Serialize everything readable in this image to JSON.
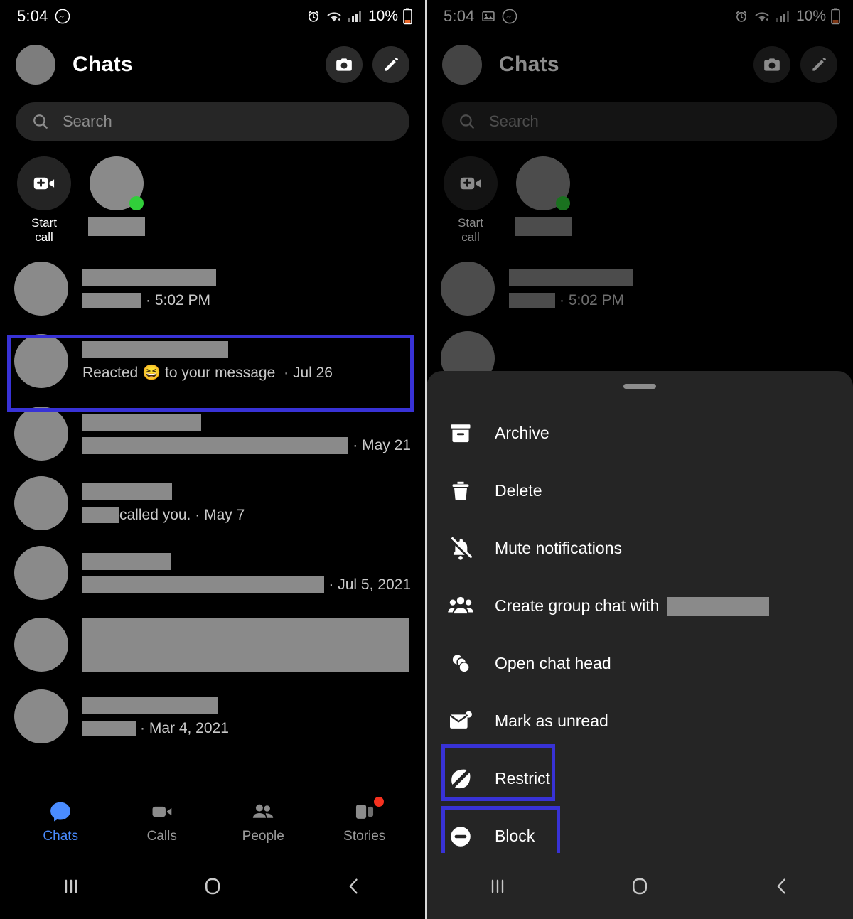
{
  "left_phone": {
    "status_bar": {
      "time": "5:04",
      "icons": [
        "messenger-icon",
        "alarm-icon",
        "wifi-icon",
        "signal-icon"
      ],
      "battery_percent": "10%"
    },
    "header": {
      "title": "Chats",
      "avatar": "profile-avatar",
      "actions": [
        {
          "name": "camera-button",
          "icon": "camera-icon"
        },
        {
          "name": "new-message-button",
          "icon": "pencil-icon"
        }
      ]
    },
    "search": {
      "placeholder": "Search",
      "icon": "search-icon"
    },
    "active_now": {
      "start_call": {
        "label_line1": "Start",
        "label_line2": "call",
        "icon": "video-plus-icon"
      },
      "contacts": [
        {
          "name_redacted": true,
          "online": true
        }
      ]
    },
    "chats": [
      {
        "name_redacted": true,
        "name_width": 188,
        "preview_redacted": true,
        "preview_width": 83,
        "preview_text": "",
        "timestamp": "5:02 PM",
        "highlighted": false
      },
      {
        "name_redacted": true,
        "name_width": 205,
        "preview_redacted": false,
        "preview_text": "Reacted 😆 to your message",
        "timestamp": "Jul 26",
        "highlighted": true
      },
      {
        "name_redacted": true,
        "name_width": 167,
        "preview_redacted": true,
        "preview_width": 388,
        "preview_text": "",
        "timestamp": "May 21",
        "highlighted": false
      },
      {
        "name_redacted": true,
        "name_width": 126,
        "preview_redacted": true,
        "preview_width": 52,
        "preview_text": "called you.",
        "timestamp": "May 7",
        "highlighted": false
      },
      {
        "name_redacted": true,
        "name_width": 124,
        "preview_redacted": true,
        "preview_width": 361,
        "preview_text": "",
        "timestamp": "Jul 5, 2021",
        "highlighted": false
      },
      {
        "name_redacted": true,
        "name_width": 460,
        "block_redacted": true,
        "preview_text": "",
        "timestamp": "",
        "highlighted": false
      },
      {
        "name_redacted": true,
        "name_width": 190,
        "preview_redacted": true,
        "preview_width": 75,
        "preview_text": "",
        "timestamp": "Mar 4, 2021",
        "highlighted": false
      }
    ],
    "bottom_nav": [
      {
        "label": "Chats",
        "icon": "chat-bubble-icon",
        "active": true,
        "badge": false
      },
      {
        "label": "Calls",
        "icon": "video-camera-icon",
        "active": false,
        "badge": false
      },
      {
        "label": "People",
        "icon": "people-icon",
        "active": false,
        "badge": false
      },
      {
        "label": "Stories",
        "icon": "stories-icon",
        "active": false,
        "badge": true
      }
    ],
    "system_nav": [
      {
        "name": "recents-button",
        "icon": "recents-icon"
      },
      {
        "name": "home-button",
        "icon": "home-icon"
      },
      {
        "name": "back-button",
        "icon": "back-chevron-icon"
      }
    ]
  },
  "right_phone": {
    "status_bar": {
      "time": "5:04",
      "icons": [
        "image-icon",
        "messenger-icon",
        "alarm-icon",
        "wifi-icon",
        "signal-icon"
      ],
      "battery_percent": "10%"
    },
    "header": {
      "title": "Chats"
    },
    "search": {
      "placeholder": "Search"
    },
    "active_now": {
      "start_call": {
        "label_line1": "Start",
        "label_line2": "call"
      }
    },
    "chats": [
      {
        "timestamp": "5:02 PM"
      }
    ],
    "sheet": {
      "grabber": "drag-handle",
      "items": [
        {
          "label": "Archive",
          "icon": "archive-box-icon",
          "highlighted": false,
          "has_redacted_name": false
        },
        {
          "label": "Delete",
          "icon": "trash-icon",
          "highlighted": false,
          "has_redacted_name": false
        },
        {
          "label": "Mute notifications",
          "icon": "bell-slash-icon",
          "highlighted": false,
          "has_redacted_name": false
        },
        {
          "label": "Create group chat with",
          "icon": "people-group-icon",
          "highlighted": false,
          "has_redacted_name": true
        },
        {
          "label": "Open chat head",
          "icon": "chat-heads-icon",
          "highlighted": false,
          "has_redacted_name": false
        },
        {
          "label": "Mark as unread",
          "icon": "envelope-unread-icon",
          "highlighted": false,
          "has_redacted_name": false
        },
        {
          "label": "Restrict",
          "icon": "restrict-icon",
          "highlighted": true,
          "has_redacted_name": false
        },
        {
          "label": "Block",
          "icon": "block-icon",
          "highlighted": true,
          "has_redacted_name": false
        }
      ]
    },
    "system_nav": [
      {
        "name": "recents-button",
        "icon": "recents-icon"
      },
      {
        "name": "home-button",
        "icon": "home-icon"
      },
      {
        "name": "back-button",
        "icon": "back-chevron-icon"
      }
    ]
  },
  "colors": {
    "highlight_border": "#3832d6",
    "accent_blue": "#4a8cff",
    "online_green": "#31cf3a",
    "badge_red": "#f6311f",
    "sheet_bg": "#252525",
    "redaction_gray": "#8a8a8a"
  }
}
